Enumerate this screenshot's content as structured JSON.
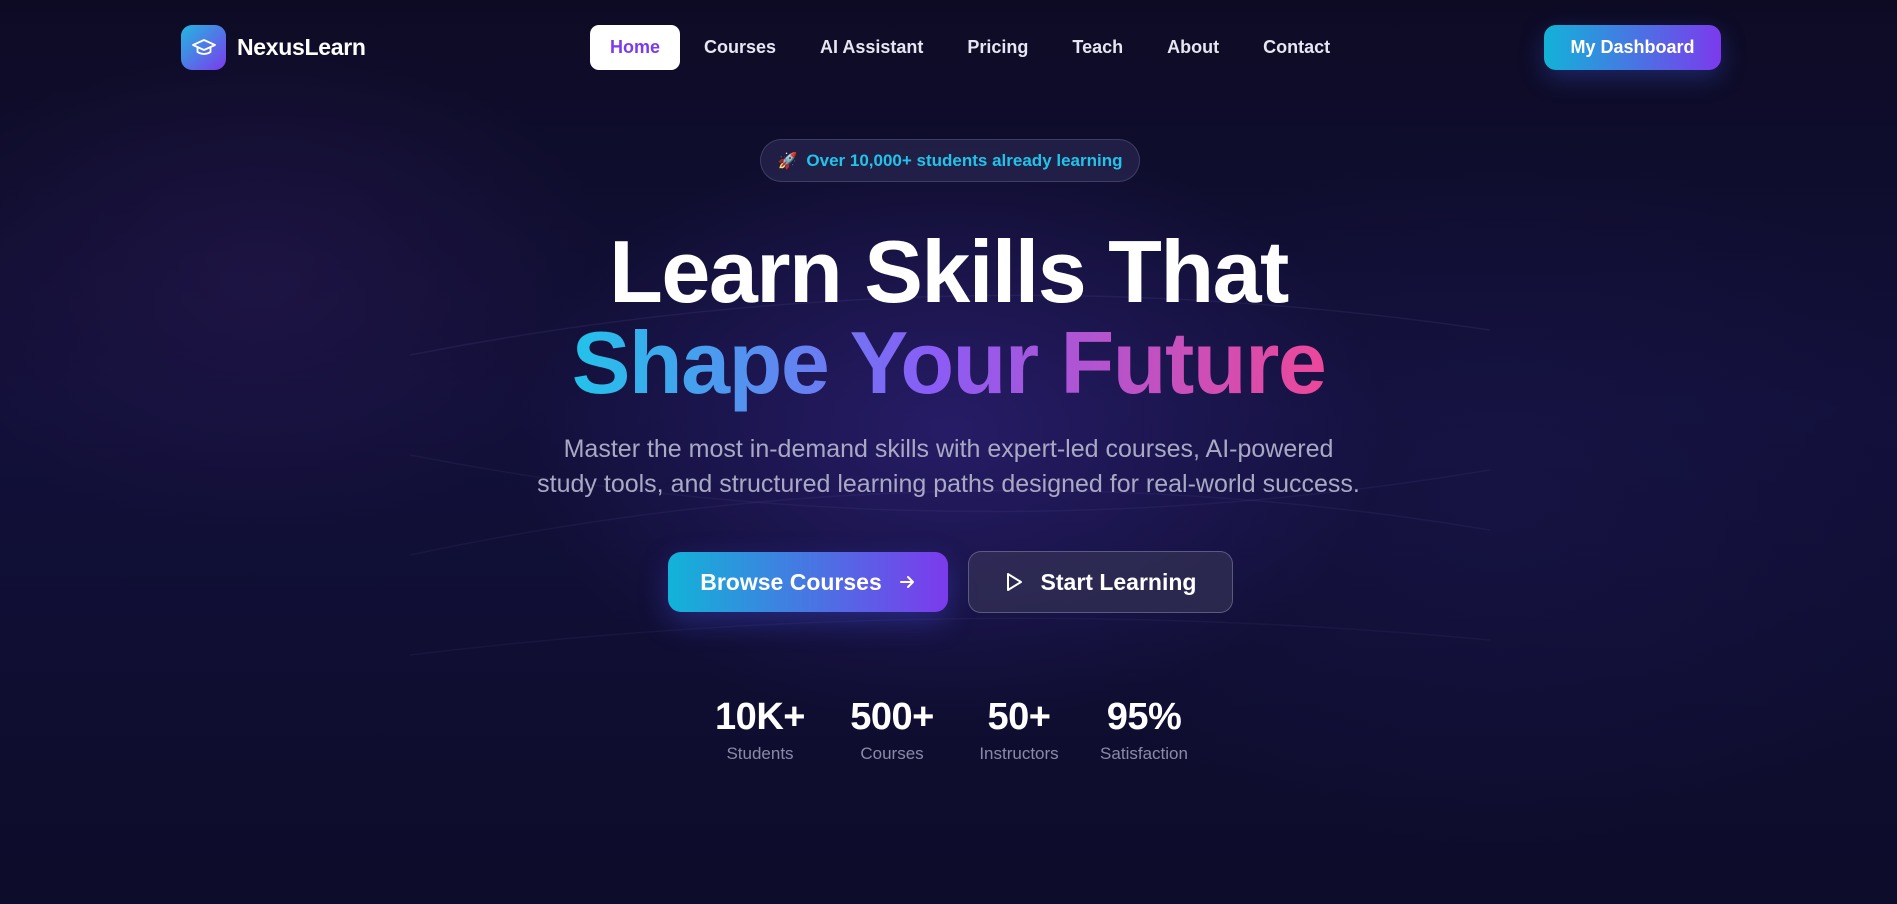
{
  "brand": {
    "name": "NexusLearn",
    "icon": "graduation-cap-icon"
  },
  "nav": {
    "items": [
      {
        "label": "Home",
        "active": true
      },
      {
        "label": "Courses"
      },
      {
        "label": "AI Assistant"
      },
      {
        "label": "Pricing"
      },
      {
        "label": "Teach"
      },
      {
        "label": "About"
      },
      {
        "label": "Contact"
      }
    ],
    "dashboard_label": "My Dashboard"
  },
  "hero": {
    "badge": {
      "emoji": "🚀",
      "text": "Over 10,000+ students already learning"
    },
    "title_line1": "Learn Skills That",
    "title_line2": "Shape Your Future",
    "subtitle_line1": "Master the most in-demand skills with expert-led courses, AI-powered",
    "subtitle_line2": "study tools, and structured learning paths designed for real-world success.",
    "primary_cta": {
      "label": "Browse Courses",
      "icon": "arrow-right-icon"
    },
    "secondary_cta": {
      "label": "Start Learning",
      "icon": "play-icon"
    }
  },
  "stats": [
    {
      "value": "10K+",
      "label": "Students"
    },
    {
      "value": "500+",
      "label": "Courses"
    },
    {
      "value": "50+",
      "label": "Instructors"
    },
    {
      "value": "95%",
      "label": "Satisfaction"
    }
  ],
  "colors": {
    "background": "#0b0b22",
    "accent_cyan": "#12b3d8",
    "accent_purple": "#7c3aed",
    "accent_pink": "#ec4899",
    "badge_text": "#22c3ea"
  }
}
